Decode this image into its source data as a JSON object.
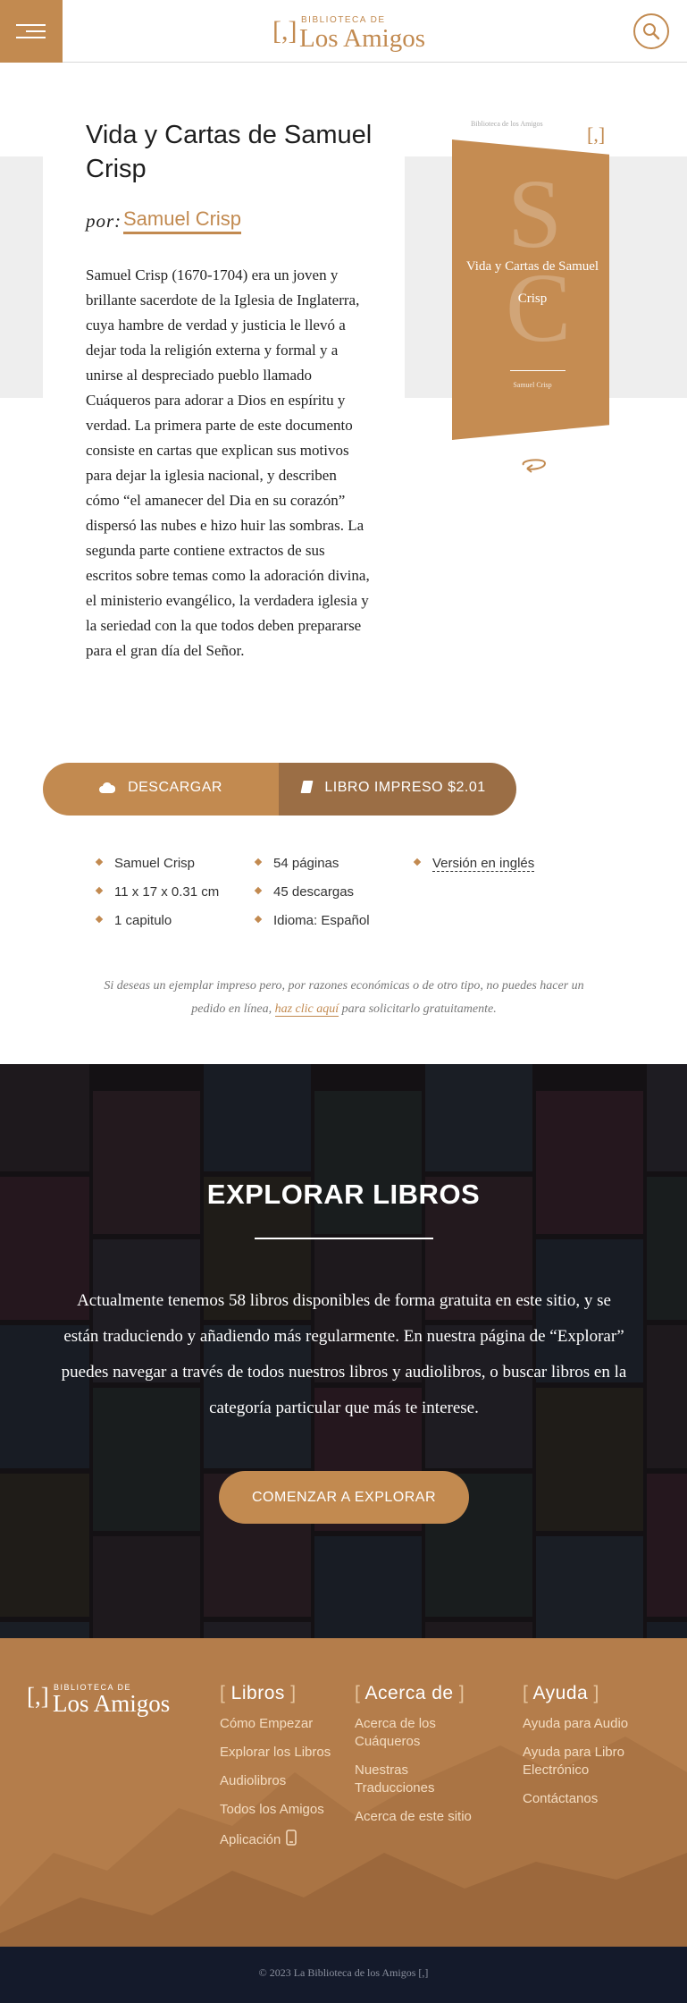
{
  "header": {
    "logo_small": "BIBLIOTECA DE",
    "logo_big": "Los Amigos",
    "logo_bracket": "[,]",
    "menu_icon": "hamburger-menu-icon",
    "search_icon": "search-icon"
  },
  "book": {
    "title": "Vida y Cartas de Samuel Crisp",
    "por_label": "por:",
    "author": "Samuel Crisp",
    "description": "Samuel Crisp (1670-1704) era un joven y brillante sacerdote de la Iglesia de Inglaterra, cuya hambre de verdad y justicia le llevó a dejar toda la religión externa y formal y a unirse al despreciado pueblo llamado Cuáqueros para adorar a Dios en espíritu y verdad. La primera parte de este documento consiste en cartas que explican sus motivos para dejar la iglesia nacional, y describen cómo “el amanecer del Dia en su corazón” dispersó las nubes e hizo huir las sombras. La segunda parte contiene extractos de sus escritos sobre temas como la adoración divina, el ministerio evangélico, la verdadera iglesia y la seriedad con la que todos deben prepararse para el gran día del Señor.",
    "cover": {
      "top_text": "Biblioteca de los Amigos",
      "top_logo": "[,]",
      "letter1": "S",
      "letter2": "C",
      "title": "Vida y Cartas de Samuel Crisp",
      "author": "Samuel Crisp",
      "color": "#c58c52"
    }
  },
  "actions": {
    "download_label": "DESCARGAR",
    "print_label": "LIBRO IMPRESO $2.01",
    "download_icon": "cloud-icon",
    "print_icon": "book-icon"
  },
  "facts": {
    "col1": [
      "Samuel Crisp",
      "11 x 17 x 0.31 cm",
      "1 capitulo"
    ],
    "col2": [
      "54 páginas",
      "45 descargas",
      "Idioma: Español"
    ],
    "col3_link": "Versión en inglés"
  },
  "note": {
    "before": "Si deseas un ejemplar impreso pero, por razones económicas o de otro tipo, no puedes hacer un pedido en línea,",
    "link": "haz clic aquí",
    "after": "para solicitarlo gratuitamente."
  },
  "explore": {
    "title": "EXPLORAR LIBROS",
    "text": "Actualmente tenemos 58 libros disponibles de forma gratuita en este sitio, y se están traduciendo y añadiendo más regularmente. En nuestra página de “Explorar” puedes navegar a través de todos nuestros libros y audiolibros, o buscar libros en la categoría particular que más te interese.",
    "button": "COMENZAR A EXPLORAR"
  },
  "footer": {
    "logo_small": "BIBLIOTECA DE",
    "logo_big": "Los Amigos",
    "logo_bracket": "[,]",
    "columns": [
      {
        "heading": "Libros",
        "links": [
          "Cómo Empezar",
          "Explorar los Libros",
          "Audiolibros",
          "Todos los Amigos",
          "Aplicación"
        ]
      },
      {
        "heading": "Acerca de",
        "links": [
          "Acerca de los Cuáqueros",
          "Nuestras Traducciones",
          "Acerca de este sitio"
        ]
      },
      {
        "heading": "Ayuda",
        "links": [
          "Ayuda para Audio",
          "Ayuda para Libro Electrónico",
          "Contáctanos"
        ]
      }
    ],
    "copyright": "© 2023 La Biblioteca de los Amigos [,]"
  },
  "colors": {
    "accent": "#c28a50",
    "print_button": "#9b6e45",
    "footer_bar": "#141a2b"
  }
}
